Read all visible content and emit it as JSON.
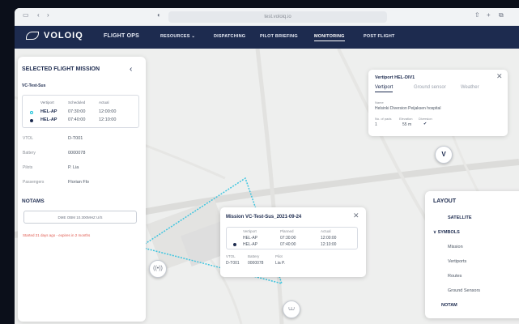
{
  "browser": {
    "url": "test.voloiq.io"
  },
  "nav": {
    "brand": "VOLOIQ",
    "items": [
      {
        "label": "FLIGHT OPS",
        "primary": true
      },
      {
        "label": "RESOURCES",
        "suffix": "⌄"
      },
      {
        "label": "DISPATCHING"
      },
      {
        "label": "PILOT BRIEFING"
      },
      {
        "label": "MONITORING",
        "active": true
      },
      {
        "label": "POST FLIGHT"
      }
    ]
  },
  "left_panel": {
    "title": "SELECTED FLIGHT MISSION",
    "mission_name": "VC-Test-Sus",
    "columns": [
      "Vertiport",
      "Scheduled",
      "Actual"
    ],
    "rows": [
      {
        "vertiport": "HEL-AP",
        "scheduled": "07:30:00",
        "actual": "12:00:00"
      },
      {
        "vertiport": "HEL-AP",
        "scheduled": "07:40:00",
        "actual": "12:10:00"
      }
    ],
    "details": [
      {
        "key": "VTOL",
        "value": "D-T001"
      },
      {
        "key": "Battery",
        "value": "0000078"
      },
      {
        "key": "Pilots",
        "value": "P. Lia"
      },
      {
        "key": "Passengers",
        "value": "Florian Flo"
      }
    ],
    "notams_title": "NOTAMS",
    "notam_item": "DME OBM 10.300MHZ U/S",
    "notam_status": "Started 21 days ago - expires in 2 months"
  },
  "vertiport_popup": {
    "title": "Vertiport HEL-DIV1",
    "tabs": [
      "Vertiport",
      "Ground sensor",
      "Weather"
    ],
    "name_label": "Name",
    "name_value": "Helsinki Diversion Peijaksen hospital",
    "pads_label": "No. of pads",
    "pads_value": "1",
    "elevation_label": "Elevation",
    "elevation_value": "55 m",
    "diversion_label": "Diversion",
    "marker_letter": "V"
  },
  "layout_panel": {
    "title": "LAYOUT",
    "items": [
      {
        "label": "SATELLITE",
        "bold": true,
        "on": false
      },
      {
        "label": "SYMBOLS",
        "bold": true,
        "on": true,
        "caret": "∨"
      },
      {
        "label": "Mission",
        "on": true
      },
      {
        "label": "Vertiports",
        "on": true
      },
      {
        "label": "Routes",
        "on": true
      },
      {
        "label": "Ground Sensors",
        "on": true
      },
      {
        "label": "NOTAM",
        "bold": true,
        "on": true
      }
    ]
  },
  "mission_popup": {
    "title": "Mission VC-Test-Sus_2021-09-24",
    "columns": [
      "Vertiport",
      "Planned",
      "Actual"
    ],
    "rows": [
      {
        "vertiport": "HEL-AP",
        "planned": "07:30:00",
        "actual": "12:00:00"
      },
      {
        "vertiport": "HEL-AP",
        "planned": "07:40:00",
        "actual": "12:10:00"
      }
    ],
    "detail_labels": [
      "VTOL",
      "Battery",
      "Pilot"
    ],
    "detail_values": [
      "D-T001",
      "0000078",
      "Lia P."
    ]
  },
  "colors": {
    "navy": "#1d2b4f",
    "accent": "#12c0d8",
    "alert": "#e05a4f"
  },
  "icons": [
    "back-chevron-icon",
    "close-icon",
    "check-icon",
    "sensor-icon",
    "drone-icon",
    "gear-icon",
    "layers-icon",
    "bell-icon",
    "zoom-in-icon",
    "zoom-out-icon"
  ]
}
